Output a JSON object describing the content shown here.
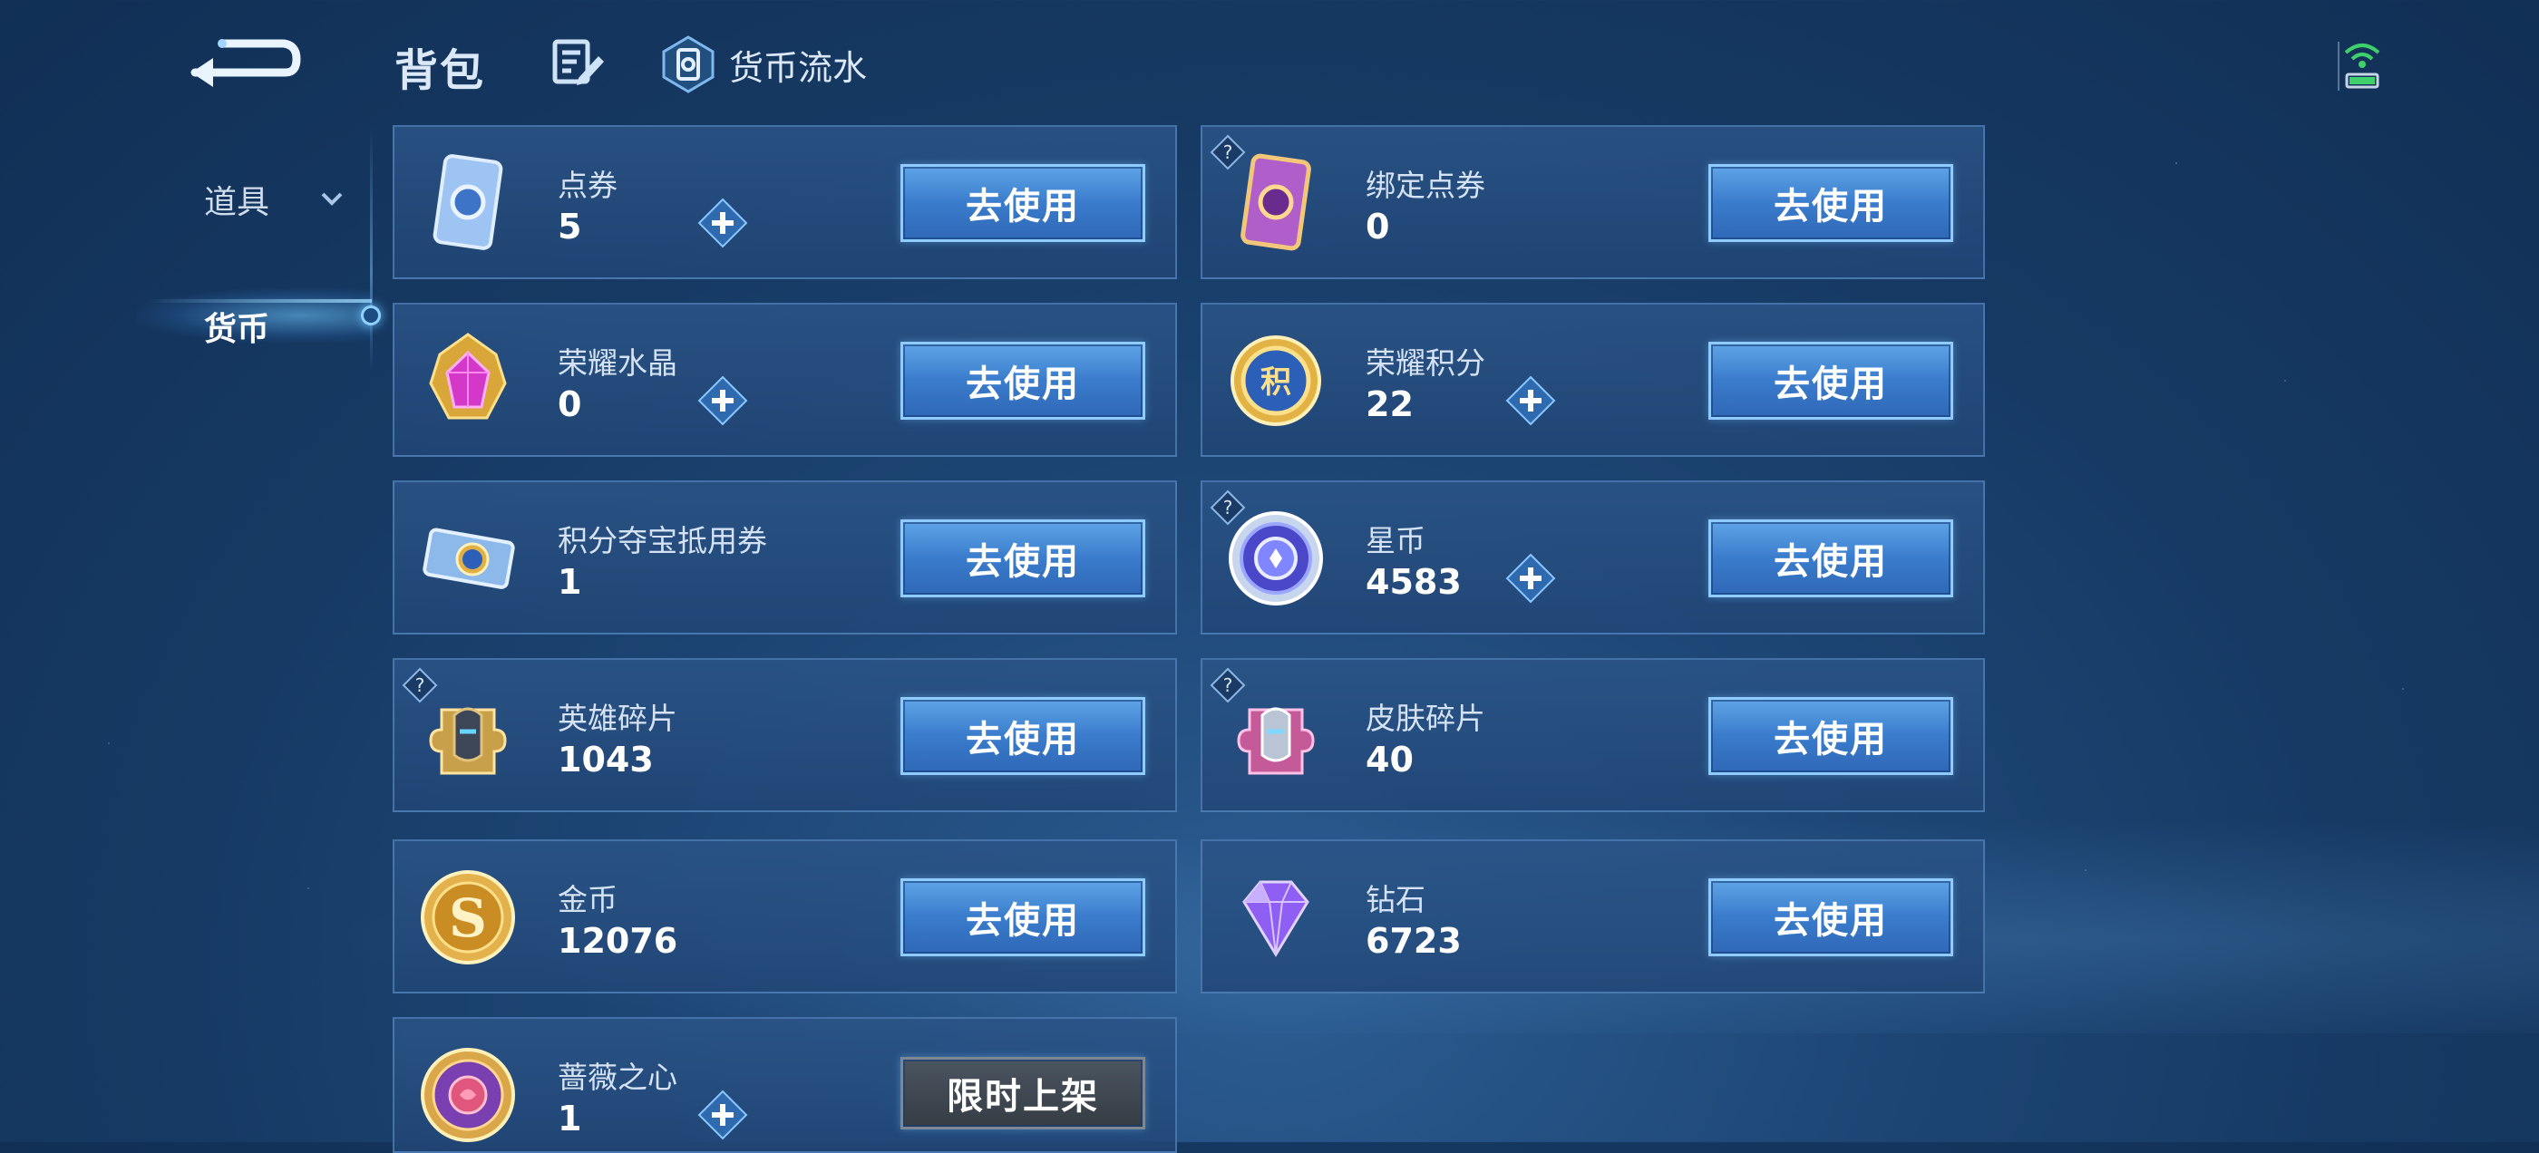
{
  "header": {
    "title": "背包",
    "flow_link": "货币流水"
  },
  "sidebar": {
    "items": [
      {
        "label": "道具",
        "active": false
      },
      {
        "label": "货币",
        "active": true
      }
    ]
  },
  "colors": {
    "button_blue": "#3a7ccc",
    "button_border": "#8fcbff",
    "card_bg": "#2b5487",
    "background": "#163a64"
  },
  "cards": [
    {
      "name": "点券",
      "amount": "5",
      "button": "去使用",
      "icon": "voucher-card-icon",
      "has_plus": true,
      "has_help": false
    },
    {
      "name": "绑定点券",
      "amount": "0",
      "button": "去使用",
      "icon": "bound-voucher-card-icon",
      "has_plus": false,
      "has_help": true
    },
    {
      "name": "荣耀水晶",
      "amount": "0",
      "button": "去使用",
      "icon": "glory-crystal-icon",
      "has_plus": true,
      "has_help": false
    },
    {
      "name": "荣耀积分",
      "amount": "22",
      "button": "去使用",
      "icon": "glory-points-coin-icon",
      "has_plus": true,
      "has_help": false
    },
    {
      "name": "积分夺宝抵用券",
      "amount": "1",
      "button": "去使用",
      "icon": "lottery-ticket-icon",
      "has_plus": false,
      "has_help": false
    },
    {
      "name": "星币",
      "amount": "4583",
      "button": "去使用",
      "icon": "star-coin-icon",
      "has_plus": true,
      "has_help": true
    },
    {
      "name": "英雄碎片",
      "amount": "1043",
      "button": "去使用",
      "icon": "hero-fragment-icon",
      "has_plus": false,
      "has_help": true
    },
    {
      "name": "皮肤碎片",
      "amount": "40",
      "button": "去使用",
      "icon": "skin-fragment-icon",
      "has_plus": false,
      "has_help": true
    },
    {
      "name": "金币",
      "amount": "12076",
      "button": "去使用",
      "icon": "gold-coin-icon",
      "has_plus": false,
      "has_help": false
    },
    {
      "name": "钻石",
      "amount": "6723",
      "button": "去使用",
      "icon": "diamond-icon",
      "has_plus": false,
      "has_help": false
    },
    {
      "name": "蔷薇之心",
      "amount": "1",
      "button": "限时上架",
      "icon": "rose-heart-icon",
      "has_plus": true,
      "has_help": false
    }
  ]
}
